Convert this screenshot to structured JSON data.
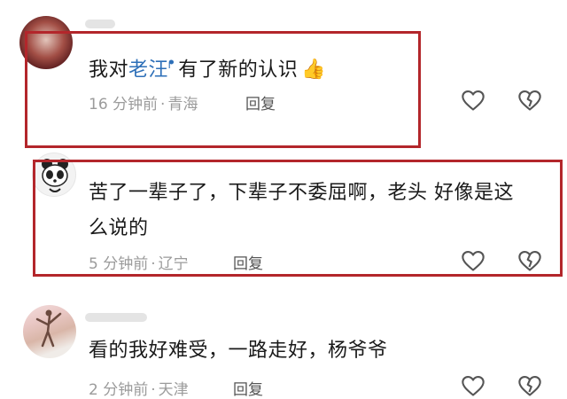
{
  "comments": [
    {
      "text_before": "我对",
      "mention": "老汪",
      "mention_mark": "ᖰ",
      "text_after": "有了新的认识",
      "emoji": "👍",
      "time": "16 分钟前",
      "location": "青海",
      "reply_label": "回复"
    },
    {
      "text_line1": "苦了一辈子了，下辈子不委屈啊，老头 好像是这",
      "text_line2": "么说的",
      "time": "5 分钟前",
      "location": "辽宁",
      "reply_label": "回复"
    },
    {
      "text_line1": "看的我好难受，一路走好，杨爷爷",
      "time": "2 分钟前",
      "location": "天津",
      "reply_label": "回复"
    }
  ],
  "meta_separator": "·",
  "colors": {
    "highlight": "#b3262b",
    "mention": "#2d6fb8"
  }
}
